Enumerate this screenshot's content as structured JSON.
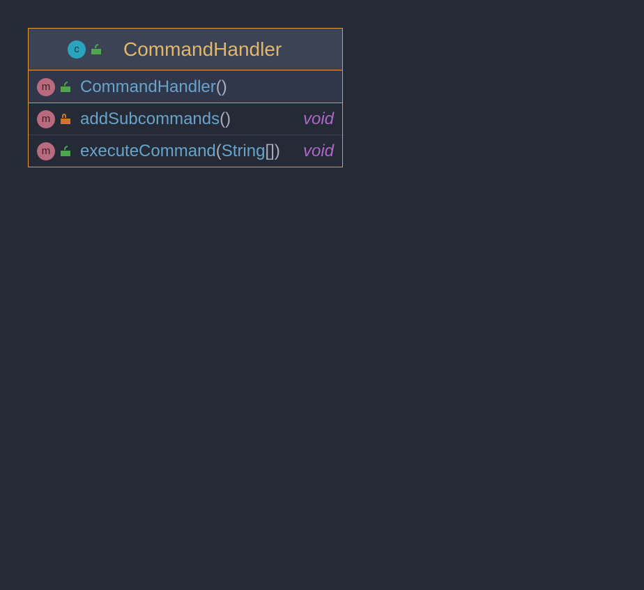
{
  "class": {
    "kind_badge": "c",
    "name": "CommandHandler",
    "visibility": "public"
  },
  "members": [
    {
      "kind_badge": "m",
      "visibility": "public",
      "name": "CommandHandler",
      "params_open": "(",
      "param_type": "",
      "param_suffix": "",
      "params_close": ")",
      "return_type": "",
      "section": "constructors"
    },
    {
      "kind_badge": "m",
      "visibility": "private",
      "name": "addSubcommands",
      "params_open": "(",
      "param_type": "",
      "param_suffix": "",
      "params_close": ")",
      "return_type": "void",
      "section": "methods"
    },
    {
      "kind_badge": "m",
      "visibility": "public",
      "name": "executeCommand",
      "params_open": "(",
      "param_type": "String",
      "param_suffix": "[]",
      "params_close": ")",
      "return_type": "void",
      "section": "methods"
    }
  ]
}
